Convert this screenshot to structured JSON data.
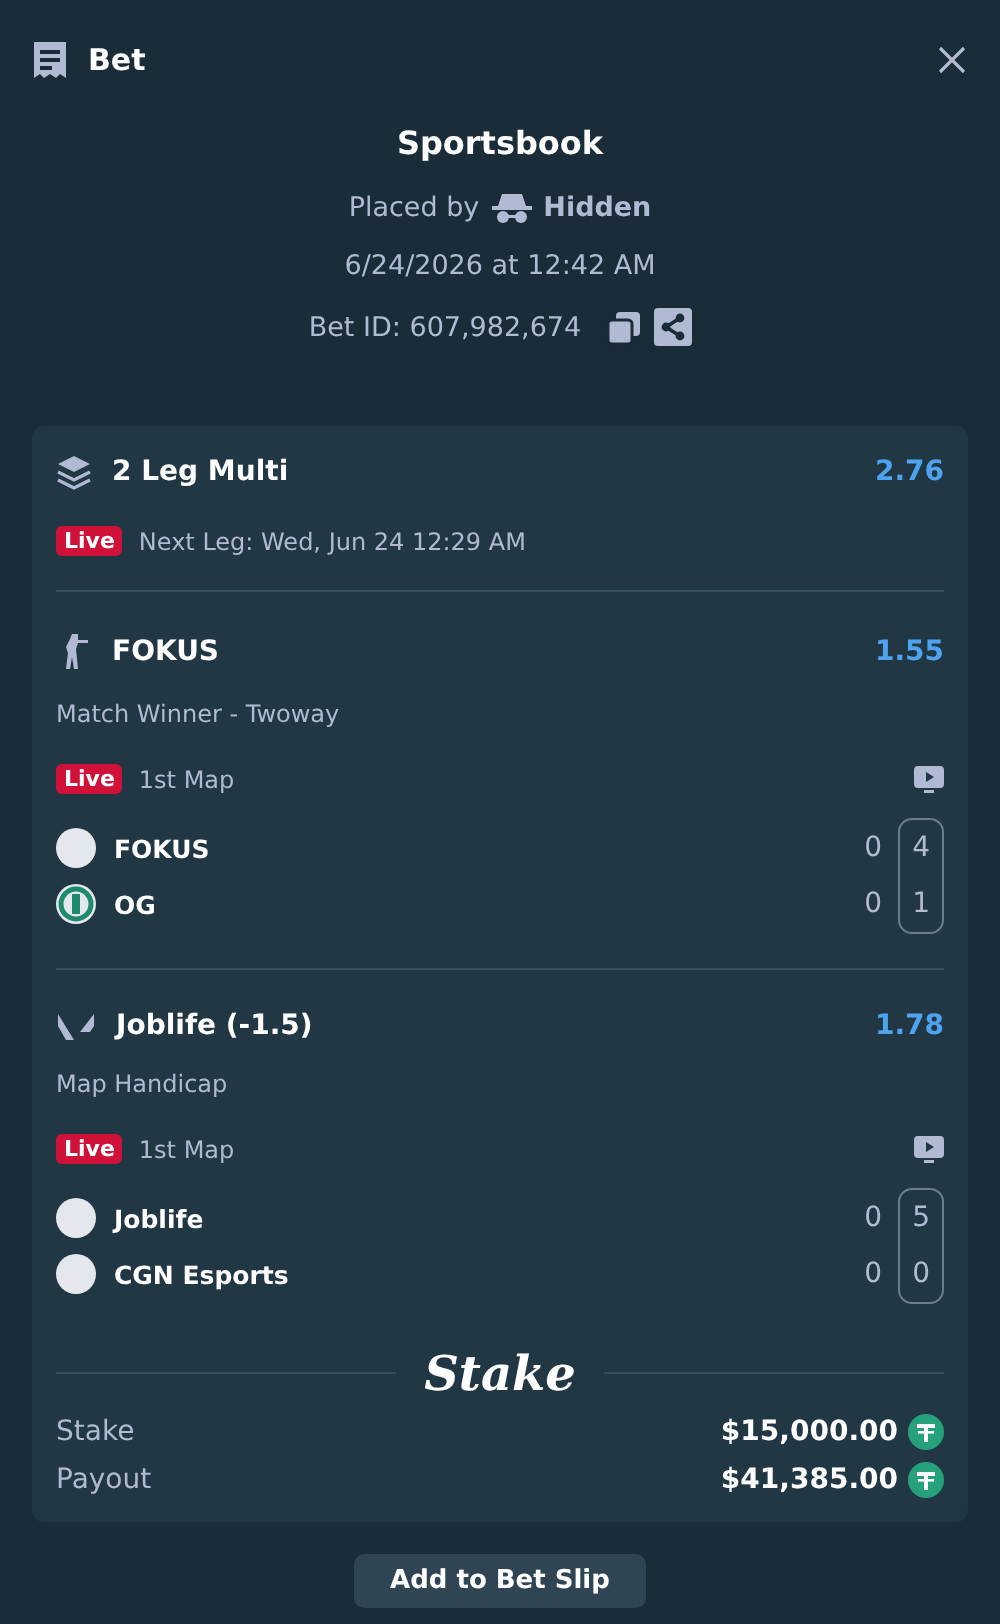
{
  "header": {
    "title": "Bet"
  },
  "summary": {
    "title": "Sportsbook",
    "placed_by": "Placed by",
    "user": "Hidden",
    "date": "6/24/2026 at 12:42 AM",
    "bet_id": "Bet ID: 607,982,674"
  },
  "multi": {
    "title": "2 Leg Multi",
    "odds": "2.76",
    "live": "Live",
    "next_leg": "Next Leg: Wed, Jun 24 12:29 AM"
  },
  "legs": [
    {
      "kind": "figure",
      "selection": "FOKUS",
      "odds": "1.55",
      "market": "Match Winner - Twoway",
      "live": "Live",
      "status": "1st Map",
      "teams": [
        {
          "kind": "plain",
          "name": "FOKUS",
          "score": "0",
          "map_score": "4"
        },
        {
          "kind": "ring",
          "name": "OG",
          "score": "0",
          "map_score": "1"
        }
      ]
    },
    {
      "kind": "blade",
      "selection": "Joblife (-1.5)",
      "odds": "1.78",
      "market": "Map Handicap",
      "live": "Live",
      "status": "1st Map",
      "teams": [
        {
          "kind": "plain",
          "name": "Joblife",
          "score": "0",
          "map_score": "5"
        },
        {
          "kind": "plain",
          "name": "CGN Esports",
          "score": "0",
          "map_score": "0"
        }
      ]
    }
  ],
  "brand": "Stake",
  "totals": [
    {
      "label": "Stake",
      "amount": "$15,000.00"
    },
    {
      "label": "Payout",
      "amount": "$41,385.00"
    }
  ],
  "button": "Add to Bet Slip"
}
